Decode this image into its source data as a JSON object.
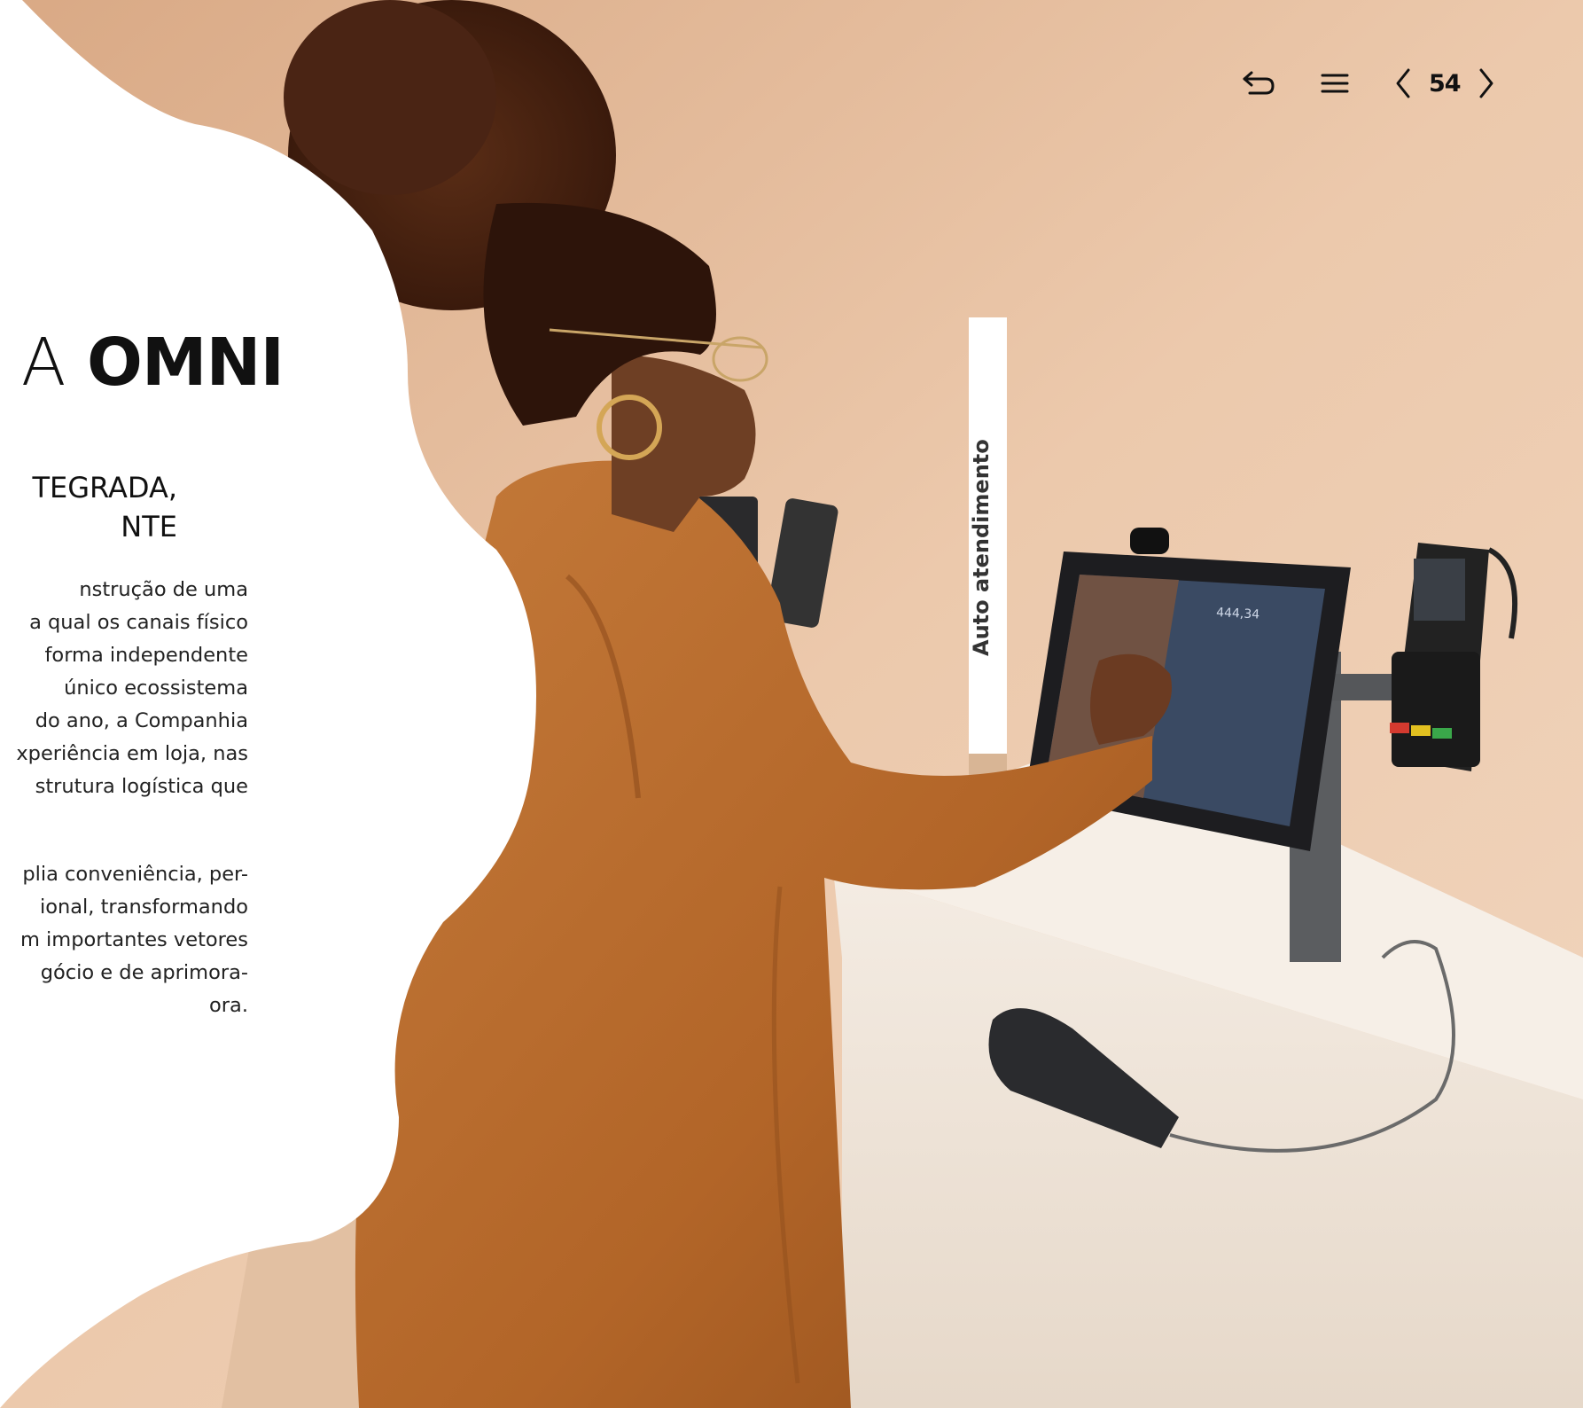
{
  "nav": {
    "back_icon": "return-arrow-icon",
    "menu_icon": "hamburger-menu-icon",
    "prev_icon": "chevron-left-icon",
    "next_icon": "chevron-right-icon",
    "page_number": "54"
  },
  "heading": {
    "prefix": "A",
    "bold": "OMNI"
  },
  "subtitle": {
    "line1": "TEGRADA,",
    "line2": "NTE"
  },
  "body": {
    "p1": [
      "nstrução de uma",
      "a qual os canais físico",
      "forma independente",
      " único ecossistema",
      "do ano, a Companhia",
      "xperiência em loja, nas",
      "strutura logística que"
    ],
    "p2": [
      "plia conveniência, per-",
      "ional, transformando",
      "m importantes vetores",
      "gócio e de aprimora-",
      "ora."
    ]
  },
  "photo": {
    "sign_text": "Auto atendimento",
    "screen_amount": "444,34"
  },
  "colors": {
    "wall": "#e9c6a8",
    "jacket": "#b8692c",
    "hair": "#4a2514",
    "counter": "#f1e7dc",
    "text": "#111111"
  }
}
